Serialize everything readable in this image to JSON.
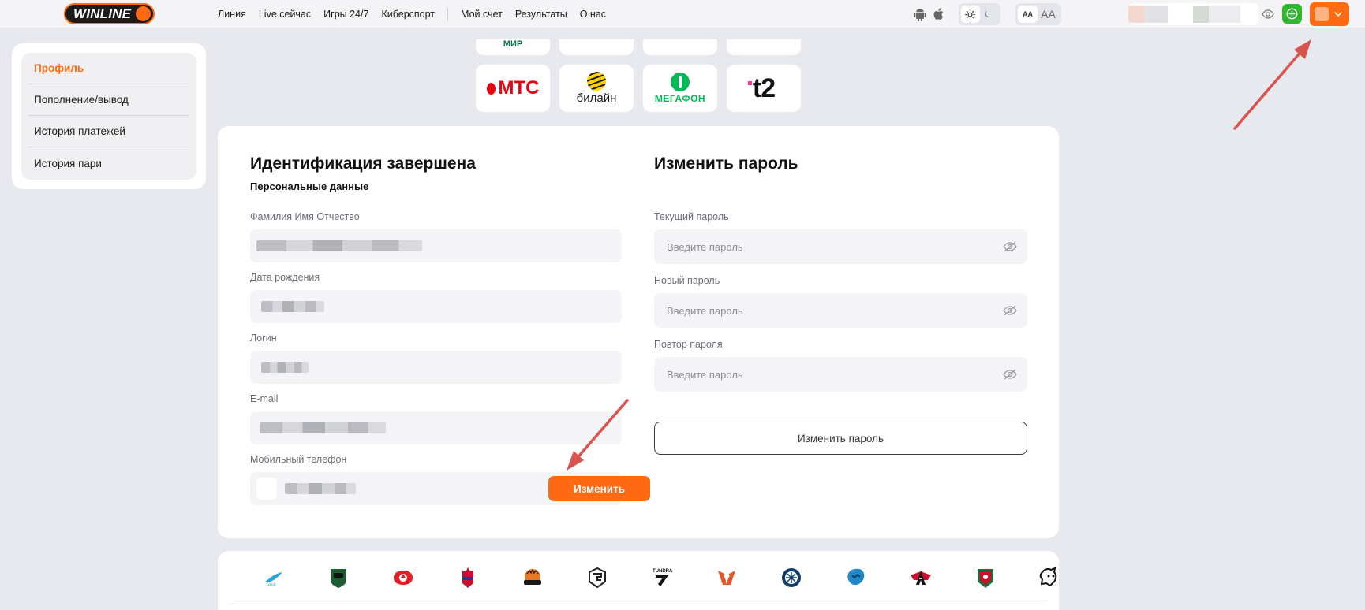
{
  "header": {
    "logo_text": "WINLINE",
    "nav": [
      {
        "label": "Линия"
      },
      {
        "label": "Live сейчас"
      },
      {
        "label": "Игры 24/7"
      },
      {
        "label": "Киберспорт"
      },
      {
        "label": "Мой счет"
      },
      {
        "label": "Результаты"
      },
      {
        "label": "О нас"
      }
    ],
    "os_icons": [
      "android-icon",
      "apple-icon"
    ],
    "theme_options": [
      "sun-icon",
      "moon-icon"
    ],
    "font_size_options": [
      "AA",
      "AA"
    ],
    "balance_hidden": true,
    "colors": {
      "brand": "#ff6a13",
      "deposit": "#2eb82e"
    }
  },
  "sidebar": {
    "items": [
      {
        "label": "Профиль",
        "active": true
      },
      {
        "label": "Пополнение/вывод",
        "active": false
      },
      {
        "label": "История платежей",
        "active": false
      },
      {
        "label": "История пари",
        "active": false
      }
    ]
  },
  "payment_logos": {
    "top_row": [
      "МИР",
      "",
      "",
      ""
    ],
    "bottom_row": [
      {
        "name": "МТС",
        "text": "МТС"
      },
      {
        "name": "Билайн",
        "text": "билайн"
      },
      {
        "name": "МегаФон",
        "text": "МЕГАФОН"
      },
      {
        "name": "t2",
        "text": "t2"
      }
    ]
  },
  "identification": {
    "title": "Идентификация завершена",
    "subtitle": "Персональные данные",
    "fields": {
      "full_name": {
        "label": "Фамилия Имя Отчество",
        "value_hidden": true
      },
      "birth_date": {
        "label": "Дата рождения",
        "value_hidden": true
      },
      "login": {
        "label": "Логин",
        "value_hidden": true
      },
      "email": {
        "label": "E-mail",
        "value_hidden": true
      },
      "phone": {
        "label": "Мобильный телефон",
        "value_hidden": true,
        "button": "Изменить"
      }
    }
  },
  "change_password": {
    "title": "Изменить пароль",
    "current": {
      "label": "Текущий пароль",
      "placeholder": "Введите пароль"
    },
    "new": {
      "label": "Новый пароль",
      "placeholder": "Введите пароль"
    },
    "repeat": {
      "label": "Повтор пароля",
      "placeholder": "Введите пароль"
    },
    "submit": "Изменить пароль"
  },
  "clubs": [
    "zenit-logo",
    "krasnodar-logo",
    "spartak-logo",
    "cska-logo",
    "unics-logo",
    "gambit-logo",
    "tundra-logo",
    "virtus-pro-logo",
    "sibir-logo",
    "tractor-logo",
    "avangard-logo",
    "ak-bars-logo",
    "metallurg-logo"
  ],
  "annotations": {
    "arrows": 2,
    "color": "#d9534f"
  }
}
